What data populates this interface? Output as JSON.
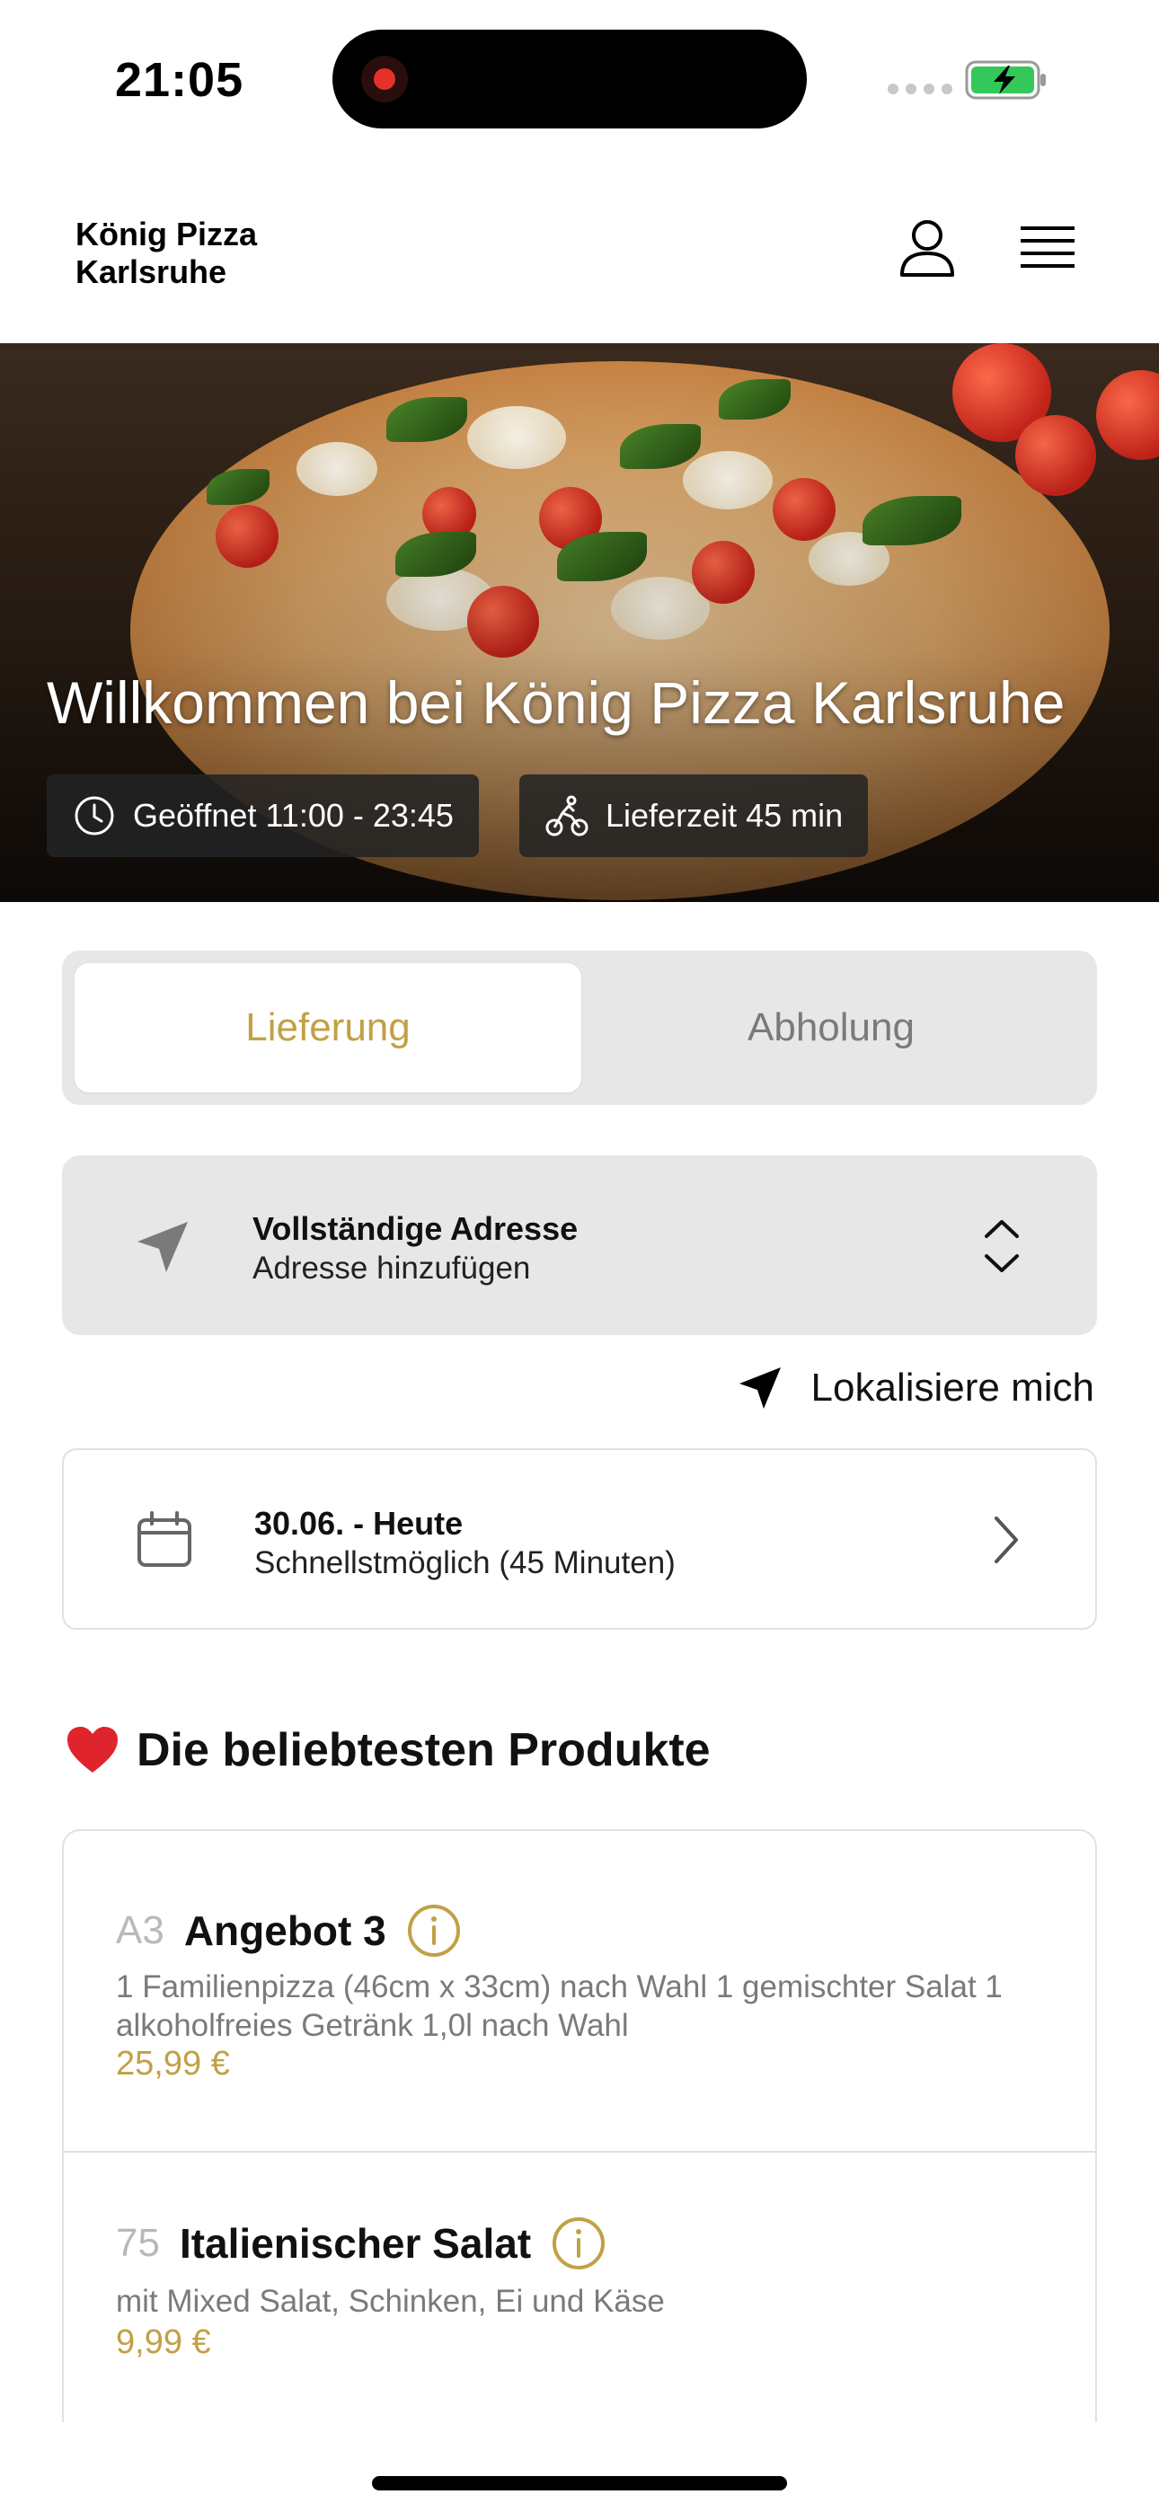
{
  "status_bar": {
    "time": "21:05"
  },
  "header": {
    "brand": "König Pizza\nKarlsruhe"
  },
  "hero": {
    "title": "Willkommen bei König Pizza Karlsruhe",
    "opening_hours": "Geöffnet 11:00 - 23:45",
    "delivery_time": "Lieferzeit 45 min"
  },
  "mode_toggle": {
    "delivery": "Lieferung",
    "pickup": "Abholung",
    "selected": "Lieferung"
  },
  "address": {
    "title": "Vollständige Adresse",
    "subtitle": "Adresse hinzufügen"
  },
  "locate_me": "Lokalisiere mich",
  "schedule": {
    "date": "30.06. - Heute",
    "time": "Schnellstmöglich (45 Minuten)"
  },
  "popular": {
    "title": "Die beliebtesten Produkte",
    "products": [
      {
        "code": "A3",
        "name": "Angebot 3",
        "description": "1 Familienpizza (46cm x 33cm) nach Wahl 1 gemischter Salat 1 alkoholfreies Getränk 1,0l nach Wahl",
        "price": "25,99 €"
      },
      {
        "code": "75",
        "name": "Italienischer Salat",
        "description": "mit Mixed Salat, Schinken, Ei und Käse",
        "price": "9,99 €"
      }
    ]
  },
  "colors": {
    "accent": "#c2a046",
    "card_bg": "#e7e7e7",
    "border": "#e1e1e1"
  }
}
